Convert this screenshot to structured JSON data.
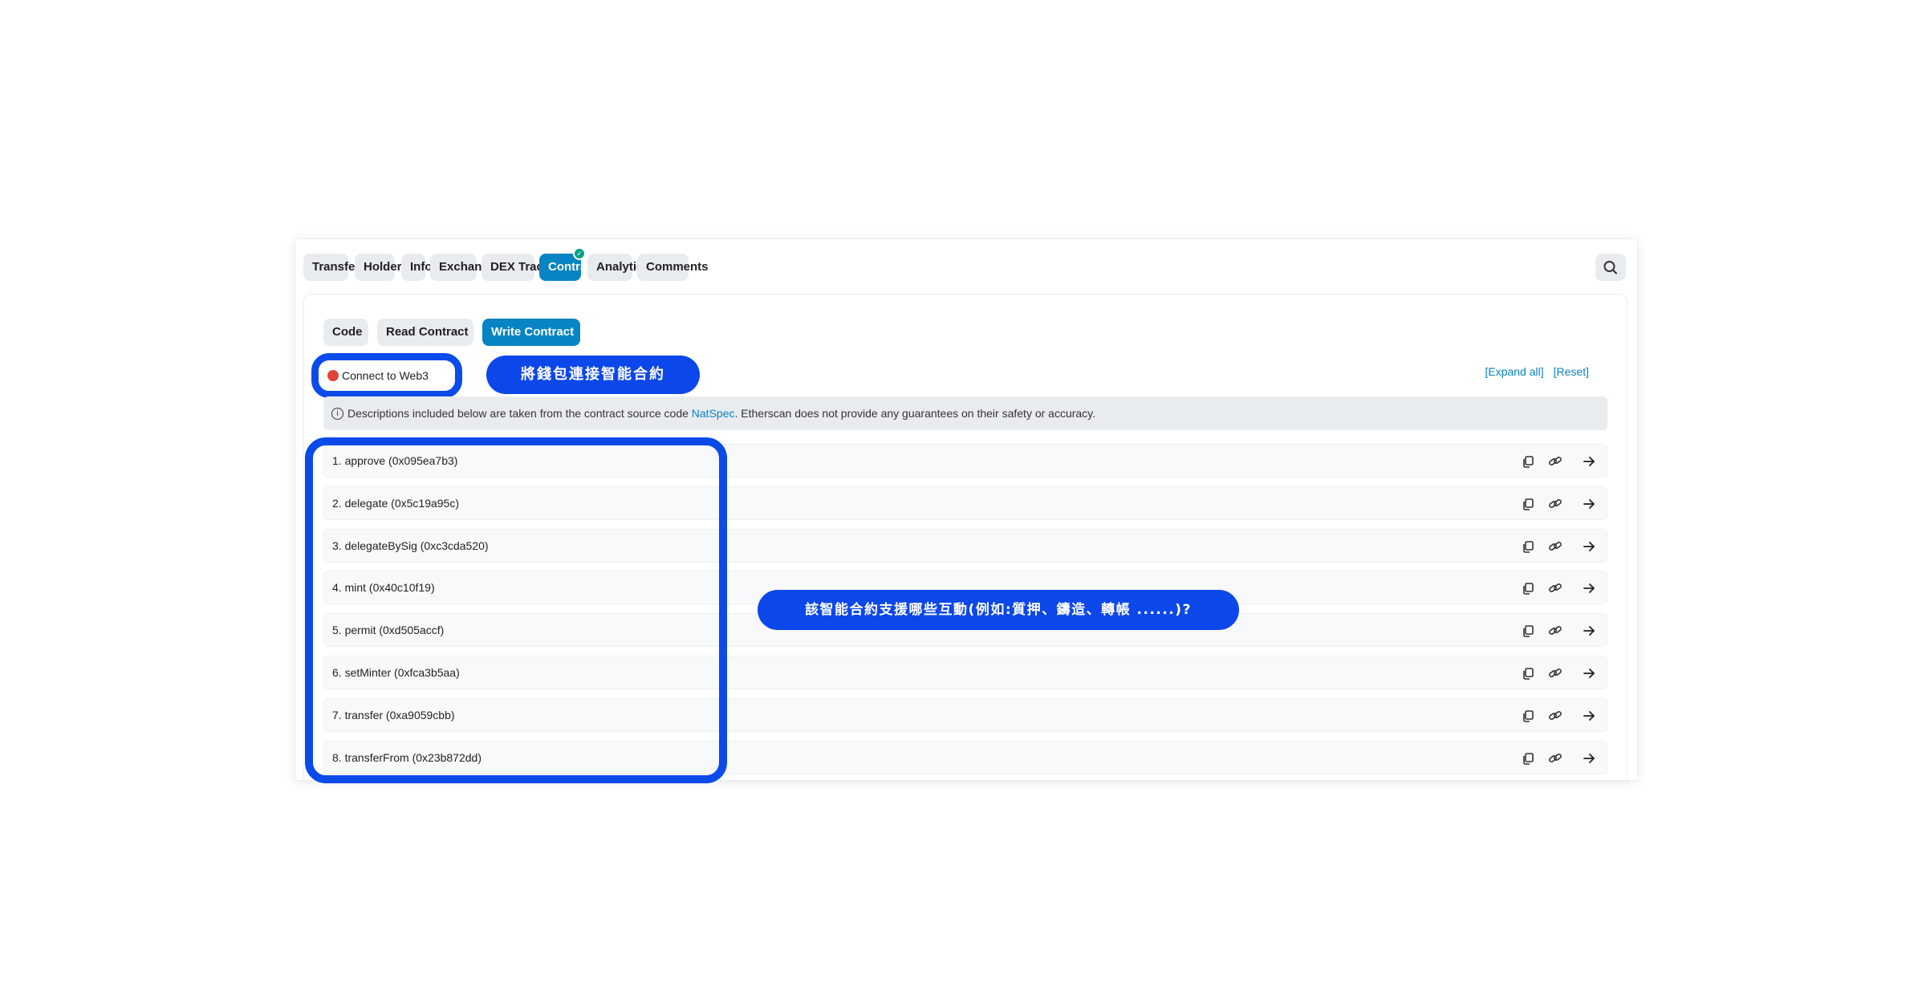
{
  "tabs": [
    "Transfers",
    "Holders",
    "Info",
    "Exchange",
    "DEX Trades",
    "Contract",
    "Analytics",
    "Comments"
  ],
  "active_tab": "Contract",
  "subtabs": [
    "Code",
    "Read Contract",
    "Write Contract"
  ],
  "connect_label": "Connect to Web3",
  "annotation_connect": "將錢包連接智能合約",
  "annotation_methods": "該智能合約支援哪些互動(例如:質押、鑄造、轉帳 ......)?",
  "expand_all": "[Expand all]",
  "reset": "[Reset]",
  "notice": {
    "before": "Descriptions included below are taken from the contract source code ",
    "link": "NatSpec",
    "after": ". Etherscan does not provide any guarantees on their safety or accuracy."
  },
  "methods": [
    "1. approve (0x095ea7b3)",
    "2. delegate (0x5c19a95c)",
    "3. delegateBySig (0xc3cda520)",
    "4. mint (0x40c10f19)",
    "5. permit (0xd505accf)",
    "6. setMinter (0xfca3b5aa)",
    "7. transfer (0xa9059cbb)",
    "8. transferFrom (0x23b872dd)"
  ],
  "icons": [
    "copy-icon",
    "link-icon",
    "arrow-right-icon",
    "search-icon",
    "check-icon",
    "info-icon"
  ],
  "colors": {
    "accent": "#0784c3",
    "annotation": "#0a4bea",
    "status_dot": "#de4437",
    "verified": "#00a186"
  }
}
